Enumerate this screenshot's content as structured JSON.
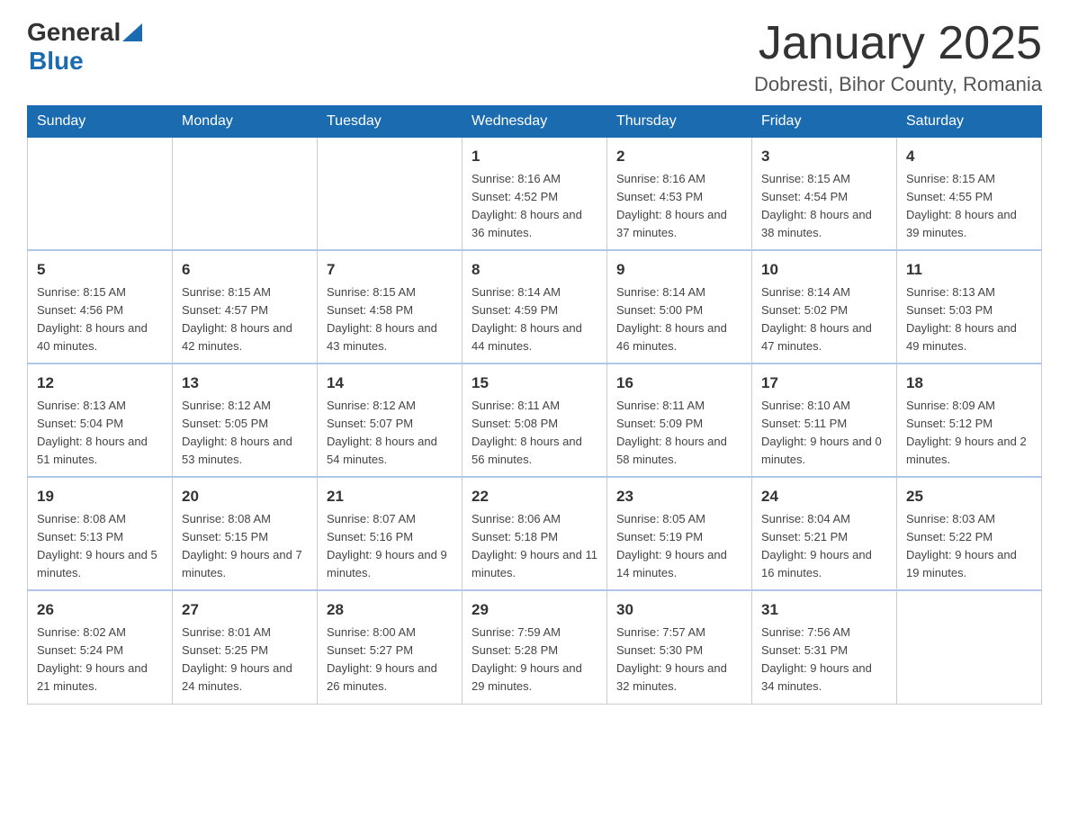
{
  "header": {
    "logo_general": "General",
    "logo_blue": "Blue",
    "title": "January 2025",
    "subtitle": "Dobresti, Bihor County, Romania"
  },
  "days_of_week": [
    "Sunday",
    "Monday",
    "Tuesday",
    "Wednesday",
    "Thursday",
    "Friday",
    "Saturday"
  ],
  "weeks": [
    {
      "days": [
        {
          "number": "",
          "info": ""
        },
        {
          "number": "",
          "info": ""
        },
        {
          "number": "",
          "info": ""
        },
        {
          "number": "1",
          "info": "Sunrise: 8:16 AM\nSunset: 4:52 PM\nDaylight: 8 hours\nand 36 minutes."
        },
        {
          "number": "2",
          "info": "Sunrise: 8:16 AM\nSunset: 4:53 PM\nDaylight: 8 hours\nand 37 minutes."
        },
        {
          "number": "3",
          "info": "Sunrise: 8:15 AM\nSunset: 4:54 PM\nDaylight: 8 hours\nand 38 minutes."
        },
        {
          "number": "4",
          "info": "Sunrise: 8:15 AM\nSunset: 4:55 PM\nDaylight: 8 hours\nand 39 minutes."
        }
      ]
    },
    {
      "days": [
        {
          "number": "5",
          "info": "Sunrise: 8:15 AM\nSunset: 4:56 PM\nDaylight: 8 hours\nand 40 minutes."
        },
        {
          "number": "6",
          "info": "Sunrise: 8:15 AM\nSunset: 4:57 PM\nDaylight: 8 hours\nand 42 minutes."
        },
        {
          "number": "7",
          "info": "Sunrise: 8:15 AM\nSunset: 4:58 PM\nDaylight: 8 hours\nand 43 minutes."
        },
        {
          "number": "8",
          "info": "Sunrise: 8:14 AM\nSunset: 4:59 PM\nDaylight: 8 hours\nand 44 minutes."
        },
        {
          "number": "9",
          "info": "Sunrise: 8:14 AM\nSunset: 5:00 PM\nDaylight: 8 hours\nand 46 minutes."
        },
        {
          "number": "10",
          "info": "Sunrise: 8:14 AM\nSunset: 5:02 PM\nDaylight: 8 hours\nand 47 minutes."
        },
        {
          "number": "11",
          "info": "Sunrise: 8:13 AM\nSunset: 5:03 PM\nDaylight: 8 hours\nand 49 minutes."
        }
      ]
    },
    {
      "days": [
        {
          "number": "12",
          "info": "Sunrise: 8:13 AM\nSunset: 5:04 PM\nDaylight: 8 hours\nand 51 minutes."
        },
        {
          "number": "13",
          "info": "Sunrise: 8:12 AM\nSunset: 5:05 PM\nDaylight: 8 hours\nand 53 minutes."
        },
        {
          "number": "14",
          "info": "Sunrise: 8:12 AM\nSunset: 5:07 PM\nDaylight: 8 hours\nand 54 minutes."
        },
        {
          "number": "15",
          "info": "Sunrise: 8:11 AM\nSunset: 5:08 PM\nDaylight: 8 hours\nand 56 minutes."
        },
        {
          "number": "16",
          "info": "Sunrise: 8:11 AM\nSunset: 5:09 PM\nDaylight: 8 hours\nand 58 minutes."
        },
        {
          "number": "17",
          "info": "Sunrise: 8:10 AM\nSunset: 5:11 PM\nDaylight: 9 hours\nand 0 minutes."
        },
        {
          "number": "18",
          "info": "Sunrise: 8:09 AM\nSunset: 5:12 PM\nDaylight: 9 hours\nand 2 minutes."
        }
      ]
    },
    {
      "days": [
        {
          "number": "19",
          "info": "Sunrise: 8:08 AM\nSunset: 5:13 PM\nDaylight: 9 hours\nand 5 minutes."
        },
        {
          "number": "20",
          "info": "Sunrise: 8:08 AM\nSunset: 5:15 PM\nDaylight: 9 hours\nand 7 minutes."
        },
        {
          "number": "21",
          "info": "Sunrise: 8:07 AM\nSunset: 5:16 PM\nDaylight: 9 hours\nand 9 minutes."
        },
        {
          "number": "22",
          "info": "Sunrise: 8:06 AM\nSunset: 5:18 PM\nDaylight: 9 hours\nand 11 minutes."
        },
        {
          "number": "23",
          "info": "Sunrise: 8:05 AM\nSunset: 5:19 PM\nDaylight: 9 hours\nand 14 minutes."
        },
        {
          "number": "24",
          "info": "Sunrise: 8:04 AM\nSunset: 5:21 PM\nDaylight: 9 hours\nand 16 minutes."
        },
        {
          "number": "25",
          "info": "Sunrise: 8:03 AM\nSunset: 5:22 PM\nDaylight: 9 hours\nand 19 minutes."
        }
      ]
    },
    {
      "days": [
        {
          "number": "26",
          "info": "Sunrise: 8:02 AM\nSunset: 5:24 PM\nDaylight: 9 hours\nand 21 minutes."
        },
        {
          "number": "27",
          "info": "Sunrise: 8:01 AM\nSunset: 5:25 PM\nDaylight: 9 hours\nand 24 minutes."
        },
        {
          "number": "28",
          "info": "Sunrise: 8:00 AM\nSunset: 5:27 PM\nDaylight: 9 hours\nand 26 minutes."
        },
        {
          "number": "29",
          "info": "Sunrise: 7:59 AM\nSunset: 5:28 PM\nDaylight: 9 hours\nand 29 minutes."
        },
        {
          "number": "30",
          "info": "Sunrise: 7:57 AM\nSunset: 5:30 PM\nDaylight: 9 hours\nand 32 minutes."
        },
        {
          "number": "31",
          "info": "Sunrise: 7:56 AM\nSunset: 5:31 PM\nDaylight: 9 hours\nand 34 minutes."
        },
        {
          "number": "",
          "info": ""
        }
      ]
    }
  ]
}
